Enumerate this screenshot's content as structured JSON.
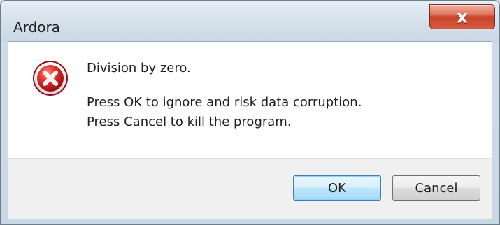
{
  "window": {
    "title": "Ardora",
    "close_symbol": "x",
    "close_icon": "close-icon"
  },
  "message": {
    "icon": "error-icon",
    "line_1": "Division by zero.",
    "line_2": "Press OK to ignore and risk data corruption.",
    "line_3": "Press Cancel to kill the program."
  },
  "buttons": {
    "ok_label": "OK",
    "cancel_label": "Cancel"
  },
  "colors": {
    "error_red": "#c8191f",
    "close_red": "#c8432a",
    "default_button_border": "#3c7fb1"
  }
}
